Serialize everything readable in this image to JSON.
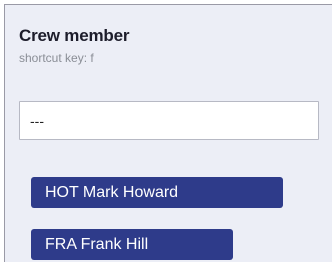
{
  "field": {
    "title": "Crew member",
    "shortcut": "shortcut key: f",
    "input_value": "---"
  },
  "selected_members": [
    {
      "label": "HOT Mark Howard"
    },
    {
      "label": "FRA Frank Hill"
    }
  ],
  "colors": {
    "panel_background": "#eceef6",
    "chip_background": "#2e3b8a",
    "chip_text": "#ffffff",
    "title_text": "#1d1d2b",
    "shortcut_text": "#8a8e96"
  }
}
